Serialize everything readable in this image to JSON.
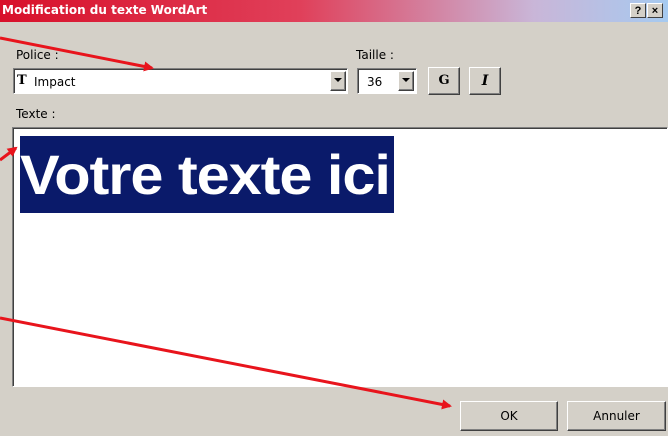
{
  "dialog": {
    "title": "Modification du texte WordArt",
    "help_button": "?",
    "close_button": "×"
  },
  "font": {
    "label": "Police :",
    "value": "Impact",
    "icon": "truetype-font-icon"
  },
  "size": {
    "label": "Taille :",
    "value": "36"
  },
  "style_buttons": {
    "bold": "G",
    "italic": "I"
  },
  "text": {
    "label": "Texte :",
    "value": "Votre texte ici"
  },
  "actions": {
    "ok": "OK",
    "cancel": "Annuler"
  },
  "annotation": {
    "arrow_color": "#e8141c"
  }
}
